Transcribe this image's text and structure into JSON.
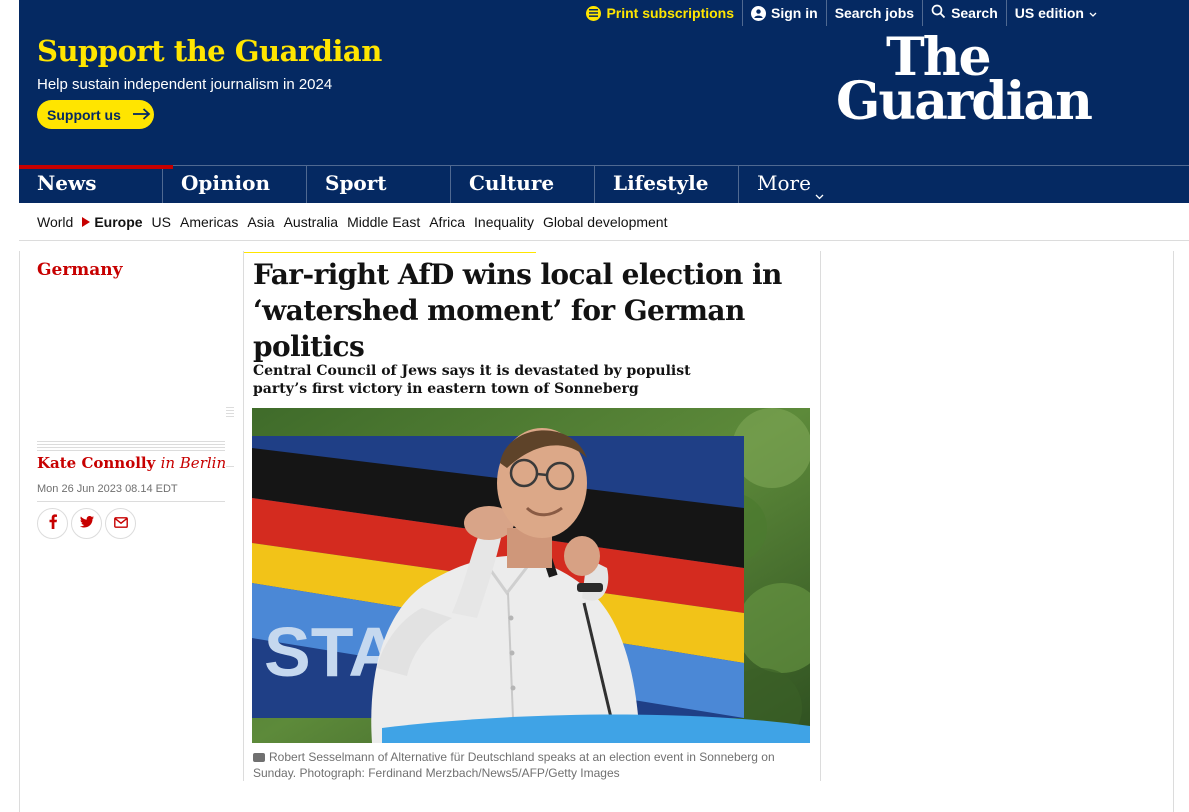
{
  "topbar": {
    "print_subscriptions": "Print subscriptions",
    "sign_in": "Sign in",
    "search_jobs": "Search jobs",
    "search": "Search",
    "edition": "US edition"
  },
  "support": {
    "title": "Support the Guardian",
    "subtitle": "Help sustain independent journalism in 2024",
    "button": "Support us"
  },
  "logo": {
    "line1": "The",
    "line2": "Guardian"
  },
  "pillars": [
    "News",
    "Opinion",
    "Sport",
    "Culture",
    "Lifestyle",
    "More"
  ],
  "subnav": [
    "World",
    "Europe",
    "US",
    "Americas",
    "Asia",
    "Australia",
    "Middle East",
    "Africa",
    "Inequality",
    "Global development"
  ],
  "article": {
    "section": "Germany",
    "headline": "Far-right AfD wins local election in ‘watershed moment’ for German politics",
    "standfirst": "Central Council of Jews says it is devastated by populist party’s first victory in eastern town of Sonneberg",
    "author": "Kate Connolly",
    "location": "in Berlin",
    "date": "Mon 26 Jun 2023 08.14 EDT",
    "photo_sign_text": "STAR",
    "caption": "Robert Sesselmann of Alternative für Deutschland speaks at an election event in Sonneberg on Sunday. Photograph: Ferdinand Merzbach/News5/AFP/Getty Images"
  },
  "colors": {
    "brand_blue": "#052962",
    "support_yellow": "#ffe500",
    "news_red": "#c70000"
  }
}
